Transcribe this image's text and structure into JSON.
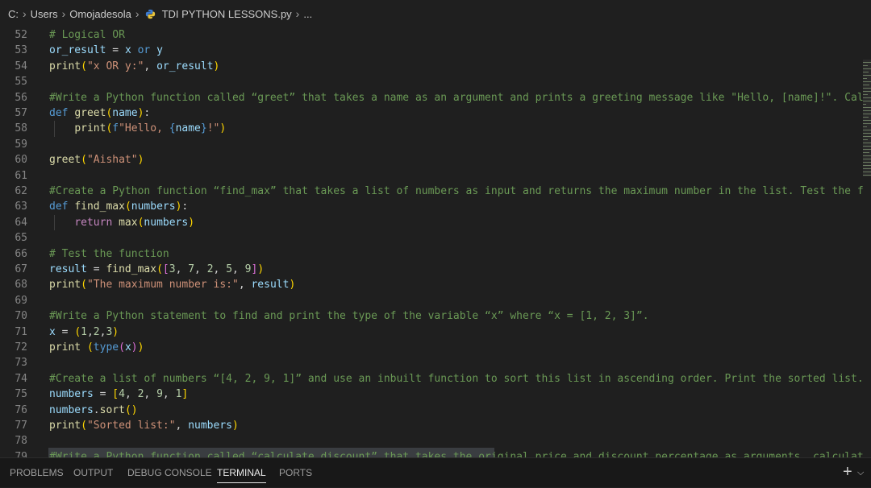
{
  "breadcrumb": {
    "drive": "C:",
    "folder1": "Users",
    "folder2": "Omojadesola",
    "file": "TDI PYTHON LESSONS.py",
    "more": "..."
  },
  "editor": {
    "line_numbers": [
      "52",
      "53",
      "54",
      "55",
      "56",
      "57",
      "58",
      "59",
      "60",
      "61",
      "62",
      "63",
      "64",
      "65",
      "66",
      "67",
      "68",
      "69",
      "70",
      "71",
      "72",
      "73",
      "74",
      "75",
      "76",
      "77",
      "78",
      "79"
    ]
  },
  "panel": {
    "tabs": [
      "PROBLEMS",
      "OUTPUT",
      "DEBUG CONSOLE",
      "TERMINAL",
      "PORTS"
    ],
    "active_tab": "TERMINAL",
    "add_icon": "plus-icon",
    "dropdown_icon": "chevron-down-icon"
  },
  "colors": {
    "background": "#1f1f1f",
    "comment": "#6a9955",
    "keyword": "#569cd6",
    "variable": "#9cdcfe",
    "function": "#dcdcaa",
    "string": "#ce9178",
    "number": "#b5cea8"
  }
}
